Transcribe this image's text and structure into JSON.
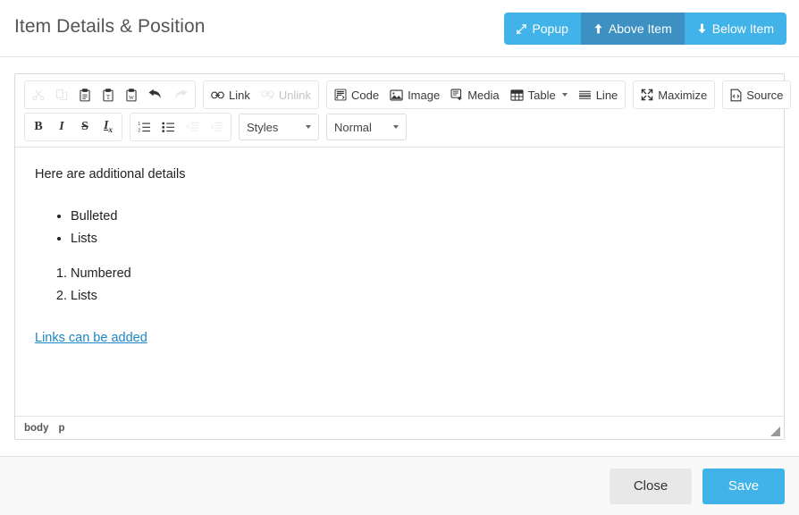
{
  "header": {
    "title": "Item Details & Position",
    "position_buttons": [
      {
        "label": "Popup",
        "icon": "expand-arrows-icon",
        "active": false
      },
      {
        "label": "Above Item",
        "icon": "arrow-up-icon",
        "active": true
      },
      {
        "label": "Below Item",
        "icon": "arrow-down-icon",
        "active": false
      }
    ]
  },
  "editor": {
    "toolbar": {
      "row1": {
        "clipboard_group": [
          {
            "name": "cut",
            "icon": "scissors-icon",
            "disabled": true
          },
          {
            "name": "copy",
            "icon": "copy-icon",
            "disabled": true
          },
          {
            "name": "paste",
            "icon": "clipboard-icon",
            "disabled": false
          },
          {
            "name": "paste-as-plain-text",
            "icon": "clipboard-text-icon",
            "disabled": false
          },
          {
            "name": "paste-from-word",
            "icon": "clipboard-word-icon",
            "disabled": false
          },
          {
            "name": "undo",
            "icon": "undo-arrow-icon",
            "disabled": false
          },
          {
            "name": "redo",
            "icon": "redo-arrow-icon",
            "disabled": true
          }
        ],
        "link_group": [
          {
            "name": "link",
            "label": "Link",
            "icon": "chain-link-icon",
            "disabled": false
          },
          {
            "name": "unlink",
            "label": "Unlink",
            "icon": "broken-chain-icon",
            "disabled": true
          }
        ],
        "insert_group": [
          {
            "name": "code",
            "label": "Code",
            "icon": "code-block-icon",
            "disabled": false,
            "caret": false
          },
          {
            "name": "image",
            "label": "Image",
            "icon": "image-icon",
            "disabled": false,
            "caret": false
          },
          {
            "name": "media",
            "label": "Media",
            "icon": "media-icon",
            "disabled": false,
            "caret": false
          },
          {
            "name": "table",
            "label": "Table",
            "icon": "table-grid-icon",
            "disabled": false,
            "caret": true
          },
          {
            "name": "line",
            "label": "Line",
            "icon": "horizontal-rule-icon",
            "disabled": false,
            "caret": false
          }
        ],
        "maximize_group": [
          {
            "name": "maximize",
            "label": "Maximize",
            "icon": "maximize-icon",
            "disabled": false
          }
        ],
        "source_group": [
          {
            "name": "source",
            "label": "Source",
            "icon": "source-code-icon",
            "disabled": false
          }
        ]
      },
      "row2": {
        "format_group": [
          {
            "name": "bold",
            "label": "B",
            "icon": "bold-icon",
            "disabled": false
          },
          {
            "name": "italic",
            "label": "I",
            "icon": "italic-icon",
            "disabled": false
          },
          {
            "name": "strikethrough",
            "label": "S",
            "icon": "strikethrough-icon",
            "disabled": false
          },
          {
            "name": "remove-format",
            "label": "Tx",
            "icon": "remove-format-icon",
            "disabled": false
          }
        ],
        "list_group": [
          {
            "name": "numbered-list",
            "icon": "numbered-list-icon",
            "disabled": false
          },
          {
            "name": "bulleted-list",
            "icon": "bulleted-list-icon",
            "disabled": false
          },
          {
            "name": "outdent",
            "icon": "outdent-icon",
            "disabled": true
          },
          {
            "name": "indent",
            "icon": "indent-icon",
            "disabled": true
          }
        ],
        "styles_select": {
          "value": "Styles"
        },
        "format_select": {
          "value": "Normal"
        }
      }
    },
    "content": {
      "paragraph": "Here are additional details",
      "bulleted_list": [
        "Bulleted",
        "Lists"
      ],
      "numbered_list": [
        "Numbered",
        "Lists"
      ],
      "link_text": "Links can be added"
    },
    "status_path": [
      "body",
      "p"
    ]
  },
  "footer": {
    "close_label": "Close",
    "save_label": "Save"
  },
  "colors": {
    "accent_blue": "#41b3e8",
    "accent_blue_active": "#3c90c2",
    "link_blue": "#1d86c8",
    "footer_bg": "#f9f9f9",
    "close_bg": "#e8e8e8"
  }
}
